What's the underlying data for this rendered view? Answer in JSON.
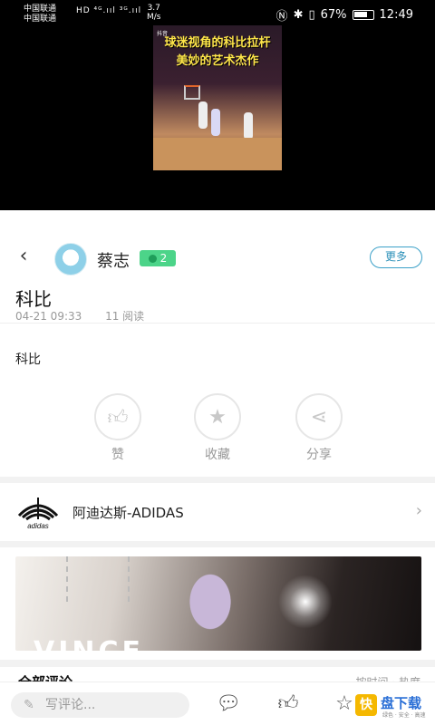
{
  "status_bar": {
    "carrier_1": "中国联通",
    "carrier_2": "中国联通",
    "net_icons": "HD ⁴ᴳ.ııl ³ᴳ.ııl",
    "net_speed_value": "3.7",
    "net_speed_unit": "M/s",
    "battery_percent": "67%",
    "time": "12:49"
  },
  "video": {
    "watermark": "抖音",
    "caption_line_1": "球迷视角的科比拉杆",
    "caption_line_2": "美妙的艺术杰作"
  },
  "header": {
    "back_icon": "back-arrow",
    "username": "蔡志",
    "level": "2",
    "more_label": "更多"
  },
  "post": {
    "title": "科比",
    "date": "04-21 09:33",
    "reads": "11 阅读",
    "body": "科比"
  },
  "actions": [
    {
      "label": "赞",
      "icon": "thumb-up"
    },
    {
      "label": "收藏",
      "icon": "star"
    },
    {
      "label": "分享",
      "icon": "share"
    }
  ],
  "brand": {
    "name": "阿迪达斯-ADIDAS",
    "logo_text": "adidas"
  },
  "banner": {
    "text": "VINCE"
  },
  "comments": {
    "title": "全部评论",
    "sort": "按时间 · 热度"
  },
  "bottom_bar": {
    "comment_placeholder": "写评论...",
    "icons": [
      "comment",
      "thumb-up",
      "star"
    ]
  },
  "site_watermark": {
    "badge": "快",
    "name": "盘下载",
    "sub": "绿色 · 安全 · 高速"
  },
  "colors": {
    "accent": "#2a8fb8",
    "badge": "#4cd489",
    "watermark_yellow": "#f5b800"
  }
}
